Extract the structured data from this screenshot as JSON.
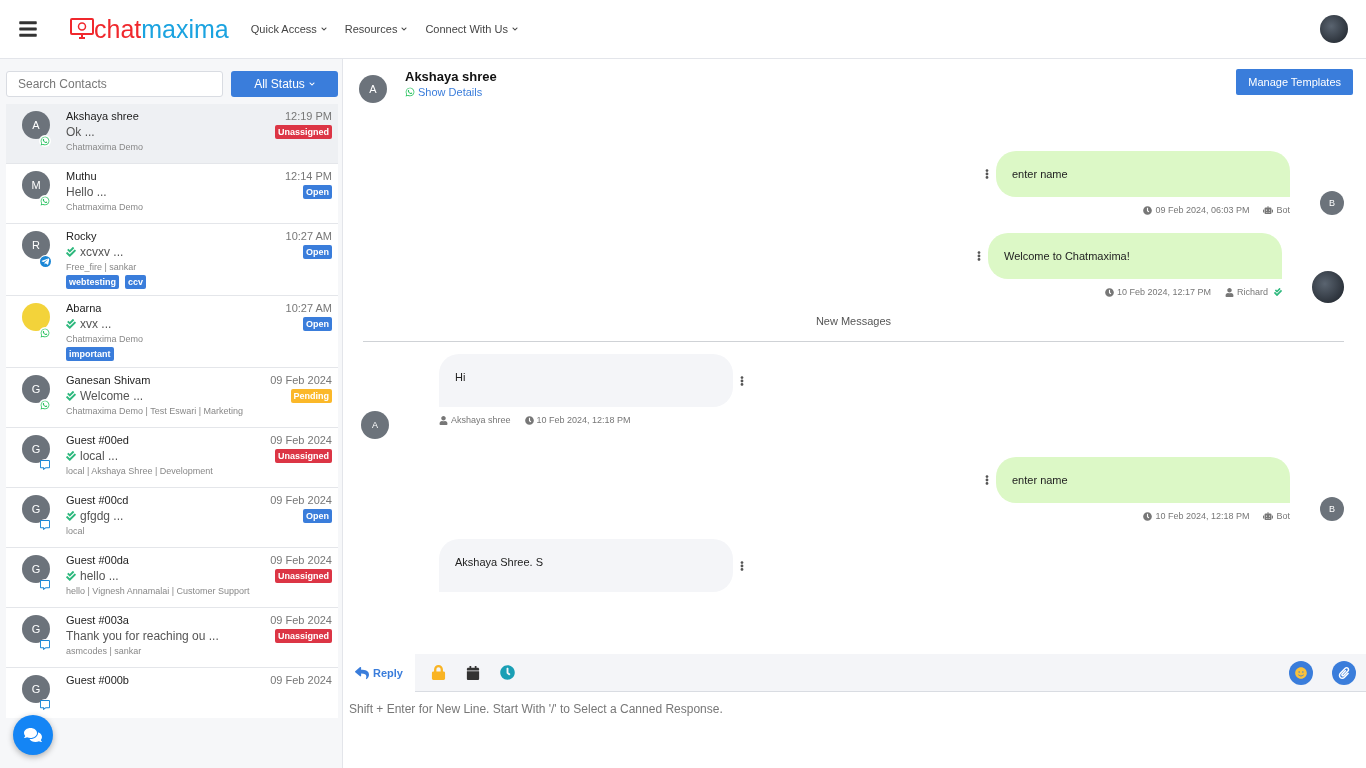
{
  "header": {
    "logo": {
      "first": "chat",
      "second": "maxima"
    },
    "nav": [
      {
        "label": "Quick Access"
      },
      {
        "label": "Resources"
      },
      {
        "label": "Connect With Us"
      }
    ]
  },
  "contacts_panel": {
    "search": {
      "placeholder": "Search Contacts"
    },
    "filter": "All Status",
    "contacts": [
      {
        "name": "Akshaya shree",
        "avatar": {
          "kind": "letter",
          "text": "A"
        },
        "channel": {
          "kind": "whatsapp"
        },
        "preview": "Ok ...",
        "read": false,
        "meta": "Chatmaxima Demo",
        "time": "12:19 PM",
        "status": {
          "label": "Unassigned",
          "kind": "unassigned"
        },
        "selected": true
      },
      {
        "name": "Muthu",
        "avatar": {
          "kind": "letter",
          "text": "M"
        },
        "channel": {
          "kind": "whatsapp"
        },
        "preview": "Hello ...",
        "read": false,
        "meta": "Chatmaxima Demo",
        "time": "12:14 PM",
        "status": {
          "label": "Open",
          "kind": "open"
        },
        "selected": false
      },
      {
        "name": "Rocky",
        "avatar": {
          "kind": "letter",
          "text": "R"
        },
        "channel": {
          "kind": "telegram"
        },
        "preview": "xcvxv ...",
        "read": true,
        "meta": "Free_fire | sankar",
        "time": "10:27 AM",
        "status": {
          "label": "Open",
          "kind": "open"
        },
        "tags": [
          "webtesting",
          "ccv"
        ],
        "selected": false
      },
      {
        "name": "Abarna",
        "avatar": {
          "kind": "picture"
        },
        "channel": {
          "kind": "whatsapp"
        },
        "preview": "xvx ...",
        "read": true,
        "meta": "Chatmaxima Demo",
        "time": "10:27 AM",
        "status": {
          "label": "Open",
          "kind": "open"
        },
        "tags": [
          "important"
        ],
        "selected": false
      },
      {
        "name": "Ganesan Shivam",
        "avatar": {
          "kind": "letter",
          "text": "G"
        },
        "channel": {
          "kind": "whatsapp"
        },
        "preview": "Welcome ...",
        "read": true,
        "meta": "Chatmaxima Demo | Test Eswari | Marketing",
        "time": "09 Feb 2024",
        "status": {
          "label": "Pending",
          "kind": "pending"
        },
        "selected": false
      },
      {
        "name": "Guest #00ed",
        "avatar": {
          "kind": "letter",
          "text": "G"
        },
        "channel": {
          "kind": "webchat"
        },
        "preview": "local ...",
        "read": true,
        "meta": "local | Akshaya Shree | Development",
        "time": "09 Feb 2024",
        "status": {
          "label": "Unassigned",
          "kind": "unassigned"
        },
        "selected": false
      },
      {
        "name": "Guest #00cd",
        "avatar": {
          "kind": "letter",
          "text": "G"
        },
        "channel": {
          "kind": "webchat"
        },
        "preview": "gfgdg ...",
        "read": true,
        "meta": "local",
        "time": "09 Feb 2024",
        "status": {
          "label": "Open",
          "kind": "open"
        },
        "selected": false
      },
      {
        "name": "Guest #00da",
        "avatar": {
          "kind": "letter",
          "text": "G"
        },
        "channel": {
          "kind": "webchat"
        },
        "preview": "hello ...",
        "read": true,
        "meta": "hello | Vignesh Annamalai | Customer Support",
        "time": "09 Feb 2024",
        "status": {
          "label": "Unassigned",
          "kind": "unassigned"
        },
        "selected": false
      },
      {
        "name": "Guest #003a",
        "avatar": {
          "kind": "letter",
          "text": "G"
        },
        "channel": {
          "kind": "webchat"
        },
        "preview": "Thank you for reaching ou ...",
        "read": false,
        "meta": "asmcodes | sankar",
        "time": "09 Feb 2024",
        "status": {
          "label": "Unassigned",
          "kind": "unassigned"
        },
        "selected": false
      },
      {
        "name": "Guest #000b",
        "avatar": {
          "kind": "letter",
          "text": "G"
        },
        "channel": {
          "kind": "webchat"
        },
        "time": "09 Feb 2024",
        "selected": false
      }
    ]
  },
  "chat": {
    "contact": {
      "name": "Akshaya shree",
      "avatar": "A",
      "details_link": "Show Details"
    },
    "manage_button": "Manage Templates",
    "messages": [
      {
        "kind": "outgoing",
        "text": "enter name",
        "time": "09 Feb 2024, 06:03 PM",
        "sender": {
          "name": "Bot",
          "kind": "bot"
        },
        "avatar": "B",
        "delivered": false
      },
      {
        "kind": "outgoing",
        "text": "Welcome to Chatmaxima!",
        "time": "10 Feb 2024, 12:17 PM",
        "sender": {
          "name": "Richard",
          "kind": "agent"
        },
        "delivered": true
      },
      {
        "kind": "divider",
        "text": "New Messages"
      },
      {
        "kind": "incoming",
        "text": "Hi",
        "sender": "Akshaya shree",
        "time": "10 Feb 2024, 12:18 PM",
        "avatar": "A"
      },
      {
        "kind": "outgoing",
        "text": "enter name",
        "time": "10 Feb 2024, 12:18 PM",
        "sender": {
          "name": "Bot",
          "kind": "bot"
        },
        "avatar": "B",
        "delivered": false
      },
      {
        "kind": "incoming",
        "text": "Akshaya Shree. S"
      }
    ],
    "composer": {
      "tabs": [
        {
          "label": "Reply",
          "kind": "reply",
          "selected": true
        },
        {
          "kind": "note",
          "selected": false
        },
        {
          "kind": "schedule",
          "selected": false
        },
        {
          "kind": "history",
          "selected": false
        }
      ],
      "placeholder": "Shift + Enter for New Line. Start With '/' to Select a Canned Response."
    }
  }
}
